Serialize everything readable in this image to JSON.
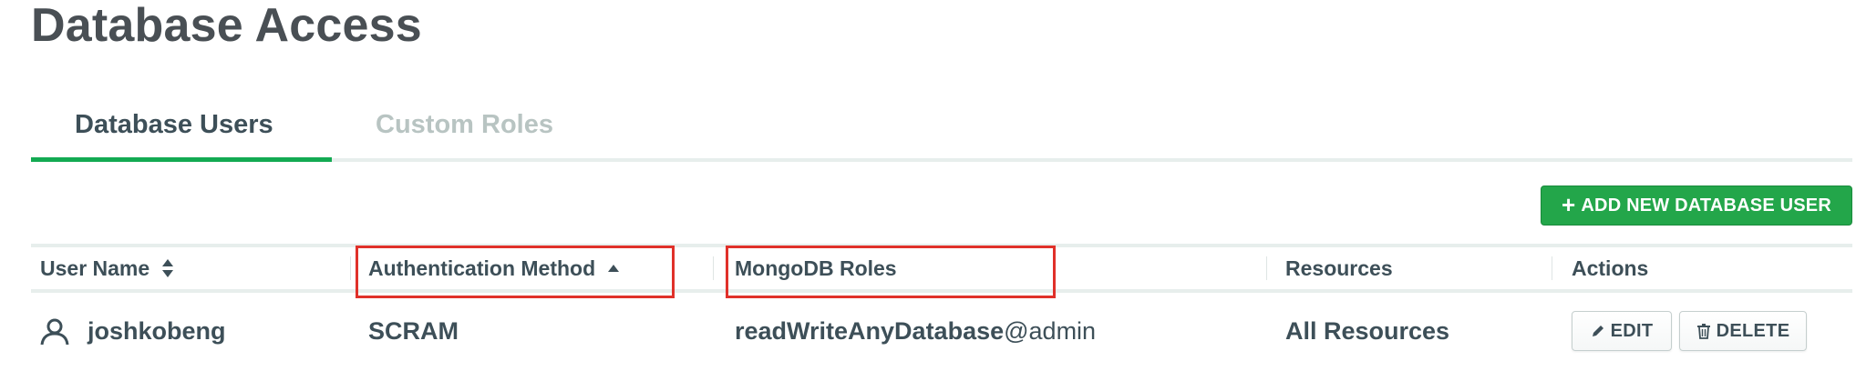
{
  "page": {
    "title": "Database Access"
  },
  "tabs": [
    {
      "label": "Database Users",
      "active": true
    },
    {
      "label": "Custom Roles",
      "active": false
    }
  ],
  "toolbar": {
    "add_user_label": "ADD NEW DATABASE USER",
    "add_icon": "plus-icon"
  },
  "table": {
    "columns": [
      {
        "label": "User Name",
        "sort": "both"
      },
      {
        "label": "Authentication Method",
        "sort": "ascending"
      },
      {
        "label": "MongoDB Roles"
      },
      {
        "label": "Resources"
      },
      {
        "label": "Actions"
      }
    ],
    "rows": [
      {
        "user_icon": "user-icon",
        "user_name": "joshkobeng",
        "auth_method": "SCRAM",
        "role_name": "readWriteAnyDatabase",
        "role_db": "@admin",
        "resources": "All Resources",
        "edit_label": "EDIT",
        "delete_label": "DELETE"
      }
    ]
  },
  "colors": {
    "accent_green": "#13aa52",
    "button_green": "#23a64a",
    "highlight_red": "#e0312a",
    "text_dark": "#3d4f58",
    "tab_inactive": "#b8c4c2"
  }
}
